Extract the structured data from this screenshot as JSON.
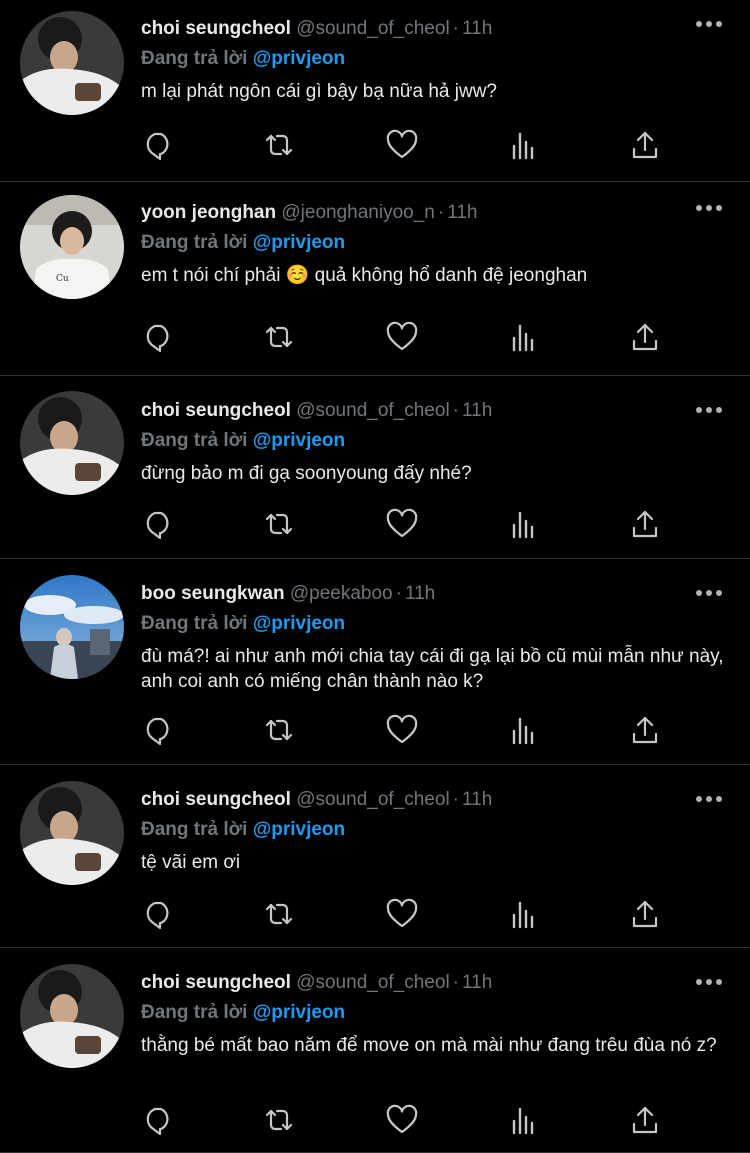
{
  "timeline": {
    "reply_prefix": "Đang trả lời",
    "tweets": [
      {
        "name": "choi seungcheol",
        "handle": "@sound_of_cheol",
        "time": "11h",
        "reply_to": "@privjeon",
        "text": "m lại phát ngôn cái gì bậy bạ nữa hả jww?",
        "avatar": "avatar-seungcheol"
      },
      {
        "name": "yoon jeonghan",
        "handle": "@jeonghaniyoo_n",
        "time": "11h",
        "reply_to": "@privjeon",
        "text": "em t nói chí phải ☺️ quả không hổ danh đệ jeonghan",
        "avatar": "avatar-jeonghan"
      },
      {
        "name": "choi seungcheol",
        "handle": "@sound_of_cheol",
        "time": "11h",
        "reply_to": "@privjeon",
        "text": "đừng bảo m đi gạ soonyoung đấy nhé?",
        "avatar": "avatar-seungcheol"
      },
      {
        "name": "boo seungkwan",
        "handle": "@peekaboo",
        "time": "11h",
        "reply_to": "@privjeon",
        "text": "đù má?! ai như anh mới chia tay cái đi gạ lại bồ cũ mùi mẫn như này, anh coi anh có miếng chân thành nào k?",
        "avatar": "avatar-seungkwan"
      },
      {
        "name": "choi seungcheol",
        "handle": "@sound_of_cheol",
        "time": "11h",
        "reply_to": "@privjeon",
        "text": "tệ vãi em ơi",
        "avatar": "avatar-seungcheol"
      },
      {
        "name": "choi seungcheol",
        "handle": "@sound_of_cheol",
        "time": "11h",
        "reply_to": "@privjeon",
        "text": "thằng bé mất bao năm để move on mà mài như đang trêu đùa nó z?",
        "avatar": "avatar-seungcheol"
      }
    ],
    "action_icons": [
      "reply-icon",
      "retweet-icon",
      "like-icon",
      "analytics-icon",
      "share-icon"
    ],
    "colors": {
      "background": "#000000",
      "text": "#e7e9ea",
      "secondary": "#71767b",
      "accent": "#1d9bf0",
      "divider": "#2f3336"
    }
  }
}
